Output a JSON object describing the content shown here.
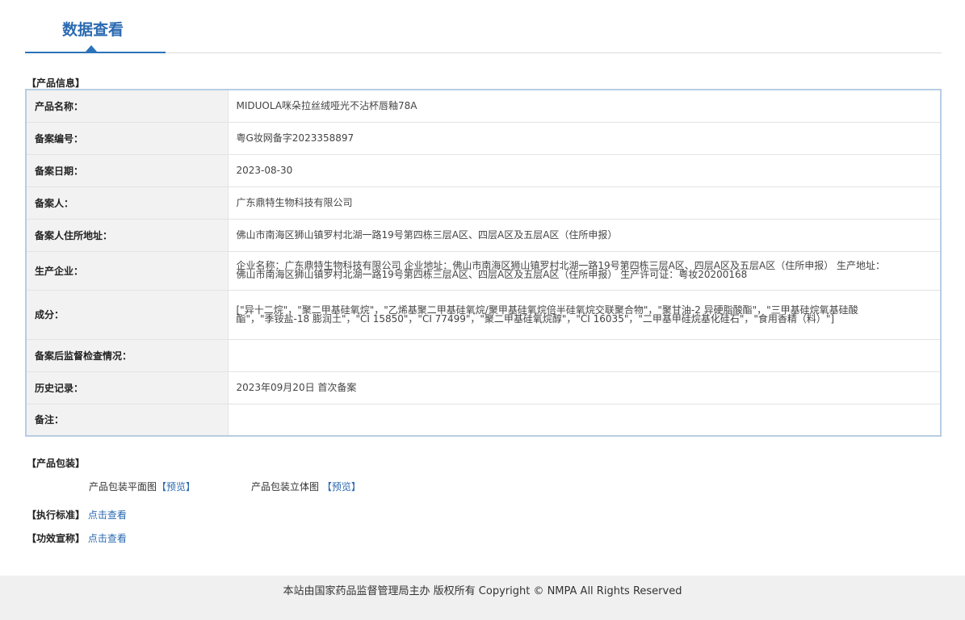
{
  "header": {
    "tab_title": "数据查看"
  },
  "product_info": {
    "heading": "【产品信息】",
    "rows": [
      {
        "label": "产品名称：",
        "value": "MIDUOLA咪朵拉丝绒哑光不沾杯唇釉78A"
      },
      {
        "label": "备案编号：",
        "value": "粤G妆网备字2023358897"
      },
      {
        "label": "备案日期：",
        "value": "2023-08-30"
      },
      {
        "label": "备案人：",
        "value": "广东鼎特生物科技有限公司"
      },
      {
        "label": "备案人住所地址：",
        "value": "佛山市南海区狮山镇罗村北湖一路19号第四栋三层A区、四层A区及五层A区（住所申报）"
      },
      {
        "label": "生产企业：",
        "value": "企业名称：广东鼎特生物科技有限公司 企业地址：佛山市南海区狮山镇罗村北湖一路19号第四栋三层A区、四层A区及五层A区（住所申报） 生产地址：佛山市南海区狮山镇罗村北湖一路19号第四栋三层A区、四层A区及五层A区（住所申报） 生产许可证：粤妆20200168"
      },
      {
        "label": "成分：",
        "value": "[\"异十二烷\"，\"聚二甲基硅氧烷\"，\"乙烯基聚二甲基硅氧烷/聚甲基硅氧烷倍半硅氧烷交联聚合物\"，\"聚甘油-2 异硬脂酸酯\"，\"三甲基硅烷氧基硅酸酯\"，\"季铵盐-18 膨润土\"，\"CI 15850\"，\"CI 77499\"，\"聚二甲基硅氧烷醇\"，\"CI 16035\"，\"二甲基甲硅烷基化硅石\"，\"食用香精（料）\"]"
      },
      {
        "label": "备案后监督检查情况：",
        "value": ""
      },
      {
        "label": "历史记录：",
        "value": "2023年09月20日 首次备案"
      },
      {
        "label": "备注：",
        "value": ""
      }
    ]
  },
  "packaging": {
    "heading": "【产品包装】",
    "flat_label": "产品包装平面图",
    "flat_link": "【预览】",
    "solid_label": "产品包装立体图",
    "solid_link": "【预览】"
  },
  "standard": {
    "label": "【执行标准】",
    "link": "点击查看"
  },
  "efficacy": {
    "label": "【功效宣称】",
    "link": "点击查看"
  },
  "footer": {
    "text": "本站由国家药品监督管理局主办 版权所有 Copyright © NMPA All Rights Reserved"
  }
}
